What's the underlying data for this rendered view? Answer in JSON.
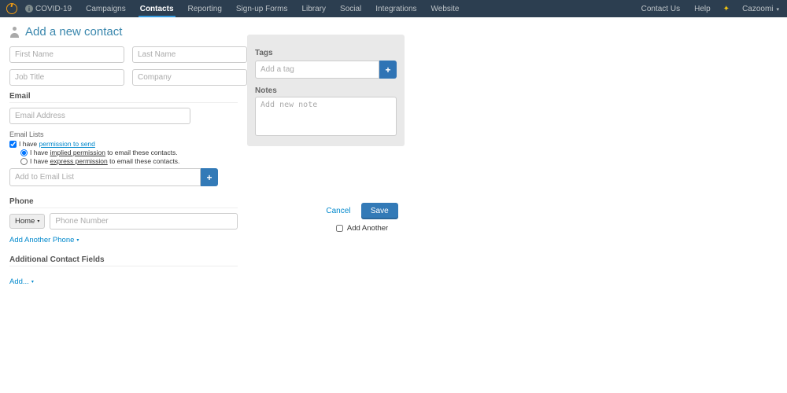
{
  "nav": {
    "covid": "COVID-19",
    "items": [
      "Campaigns",
      "Contacts",
      "Reporting",
      "Sign-up Forms",
      "Library",
      "Social",
      "Integrations",
      "Website"
    ],
    "active_index": 1,
    "contact_us": "Contact Us",
    "help": "Help",
    "user": "Cazoomi"
  },
  "page": {
    "title": "Add a new contact"
  },
  "fields": {
    "first_name_ph": "First Name",
    "last_name_ph": "Last Name",
    "job_title_ph": "Job Title",
    "company_ph": "Company",
    "email_label": "Email",
    "email_ph": "Email Address",
    "email_lists_label": "Email Lists",
    "perm_prefix": "I have ",
    "perm_link": "permission to send",
    "perm_implied_prefix": "I have ",
    "perm_implied_uline": "implied permission",
    "perm_implied_suffix": " to email these contacts.",
    "perm_express_prefix": "I have ",
    "perm_express_uline": "express permission",
    "perm_express_suffix": " to email these contacts.",
    "add_list_ph": "Add to Email List",
    "phone_label": "Phone",
    "phone_type": "Home",
    "phone_ph": "Phone Number",
    "add_phone": "Add Another Phone",
    "additional_label": "Additional Contact Fields",
    "add_field": "Add..."
  },
  "right": {
    "tags_label": "Tags",
    "tag_ph": "Add a tag",
    "notes_label": "Notes",
    "notes_ph": "Add new note"
  },
  "actions": {
    "cancel": "Cancel",
    "save": "Save",
    "add_another": "Add Another"
  }
}
